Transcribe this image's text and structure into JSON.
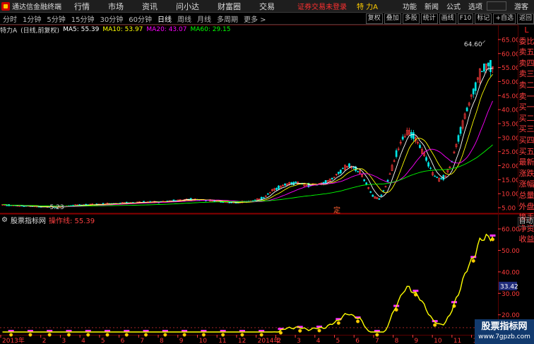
{
  "app": {
    "name": "通达信金融终端"
  },
  "menu": [
    "行情",
    "市场",
    "资讯",
    "问小达",
    "财富圈",
    "交易"
  ],
  "status": {
    "login": "证券交易未登录",
    "stock": "特 力A"
  },
  "right_menu": [
    "功能",
    "新闻",
    "公式",
    "选项"
  ],
  "guest_label": "游客",
  "periods": [
    {
      "label": "分时",
      "active": false
    },
    {
      "label": "1分钟",
      "active": false
    },
    {
      "label": "5分钟",
      "active": false
    },
    {
      "label": "15分钟",
      "active": false
    },
    {
      "label": "30分钟",
      "active": false
    },
    {
      "label": "60分钟",
      "active": false
    },
    {
      "label": "日线",
      "active": true
    },
    {
      "label": "周线",
      "active": false
    },
    {
      "label": "月线",
      "active": false
    },
    {
      "label": "多周期",
      "active": false
    },
    {
      "label": "更多 >",
      "active": false
    }
  ],
  "toolbar_buttons": [
    "复权",
    "叠加",
    "多股",
    "统计",
    "画线",
    "F10",
    "标记",
    "+自选",
    "返回"
  ],
  "title_row": {
    "stock_name": "特力A",
    "adjust": "(日线,前复权)",
    "ma5_label": "MA5: 55.39",
    "ma10_label": "MA10: 53.97",
    "ma20_label": "MA20: 43.07",
    "ma60_label": "MA60: 29.15"
  },
  "colors": {
    "up": "#ff3b3b",
    "down": "#00e5e5",
    "ma5": "#ffffff",
    "ma10": "#ffff00",
    "ma20": "#ff00ff",
    "ma60": "#00ff00",
    "grid": "#5a0000",
    "axis_text": "#ff3b3b"
  },
  "right_panel_labels": [
    "委比",
    "卖五",
    "卖四",
    "卖三",
    "卖二",
    "卖一",
    "买一",
    "买二",
    "买三",
    "买四",
    "买五",
    "最新",
    "涨跌",
    "涨幅",
    "总量",
    "外盘",
    "换手",
    "净资",
    "收益"
  ],
  "main_marker": "L",
  "auto_label": "自动",
  "center_marker": "定",
  "indicator": {
    "name": "股票指标网",
    "line_label": "操作线: 55.39"
  },
  "watermark": {
    "line1": "股票指标网",
    "line2": "www.7gpzb.com"
  },
  "chart_data": [
    {
      "type": "candlestick",
      "y_ticks": [
        5.0,
        10.0,
        15.0,
        20.0,
        25.0,
        30.0,
        35.0,
        40.0,
        45.0,
        50.0,
        55.0,
        60.0,
        65.0
      ],
      "ylim": [
        3.5,
        67.0
      ],
      "annotations": [
        {
          "label": "64.60",
          "value": 64.6
        },
        {
          "label": "5.23",
          "value": 5.23
        }
      ],
      "ma_last": {
        "MA5": 55.39,
        "MA10": 53.97,
        "MA20": 43.07,
        "MA60": 29.15
      },
      "close_trace": [
        6.0,
        5.9,
        5.8,
        5.7,
        5.6,
        5.5,
        5.4,
        5.3,
        5.3,
        5.23,
        5.4,
        5.6,
        5.8,
        5.9,
        6.0,
        6.1,
        6.2,
        6.3,
        6.4,
        6.5,
        6.6,
        6.7,
        6.8,
        6.9,
        7.0,
        7.1,
        7.0,
        7.2,
        7.3,
        7.5,
        7.8,
        8.0,
        7.9,
        7.8,
        7.7,
        7.5,
        7.3,
        7.0,
        6.9,
        6.8,
        7.0,
        7.2,
        7.5,
        8.0,
        9.0,
        11.0,
        12.0,
        13.0,
        13.5,
        14.0,
        13.5,
        13.0,
        13.2,
        13.5,
        14.0,
        15.0,
        17.0,
        19.0,
        20.0,
        19.0,
        17.0,
        13.0,
        9.0,
        8.0,
        12.0,
        18.0,
        25.0,
        30.0,
        32.0,
        30.0,
        26.0,
        22.0,
        17.0,
        15.0,
        16.0,
        20.0,
        28.0,
        35.0,
        42.0,
        48.0,
        53.0,
        56.0,
        55.39
      ]
    },
    {
      "type": "line",
      "name": "操作线",
      "y_ticks": [
        20.0,
        30.0,
        40.0,
        50.0,
        60.0
      ],
      "ylim": [
        12.0,
        62.0
      ],
      "value_marker": 33.42,
      "last": 55.39
    }
  ],
  "x_ticks": [
    "2013年",
    "2",
    "3",
    "4",
    "5",
    "6",
    "7",
    "8",
    "9",
    "10",
    "11",
    "12",
    "2014年",
    "2",
    "3",
    "4",
    "5",
    "6",
    "7",
    "8",
    "9",
    "10",
    "11",
    "12"
  ]
}
